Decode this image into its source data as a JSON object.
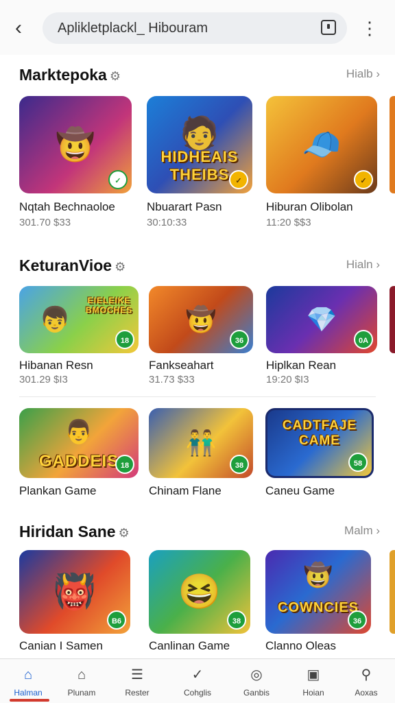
{
  "header": {
    "back_icon": "arrow-left-icon",
    "search_text": "Aplikletplackl_ Hibouram",
    "search_icon": "square-icon",
    "menu_icon": "kebab-icon"
  },
  "sections": [
    {
      "title": "Marktepoka",
      "more": "Hialb",
      "cards": [
        {
          "name": "Nqtah Bechnaoloe",
          "meta": "301.70 $33",
          "badge": "✓",
          "thumb_text": ""
        },
        {
          "name": "Nbuarart Pasn",
          "meta": "30:10:33",
          "badge": "✓",
          "thumb_text": "HIDHEAIS THEIBS"
        },
        {
          "name": "Hiburan Olibolan",
          "meta": "11:20 $$3",
          "badge": "✓",
          "thumb_text": ""
        }
      ]
    },
    {
      "title": "KeturanVioe",
      "more": "Hialn",
      "cards": [
        {
          "name": "Hibanan Resn",
          "meta": "301.29 $I3",
          "badge": "18",
          "thumb_text": "EIELEIKE BMOCHES"
        },
        {
          "name": "Fankseahart",
          "meta": "31.73 $33",
          "badge": "36",
          "thumb_text": ""
        },
        {
          "name": "Hiplkan Rean",
          "meta": "19:20 $I3",
          "badge": "0A",
          "thumb_text": ""
        }
      ]
    },
    {
      "title": "",
      "more": "",
      "cards": [
        {
          "name": "Plankan Game",
          "meta": "",
          "badge": "18",
          "thumb_text": "GADDEIS"
        },
        {
          "name": "Chinam Flane",
          "meta": "",
          "badge": "38",
          "thumb_text": ""
        },
        {
          "name": "Caneu Game",
          "meta": "",
          "badge": "58",
          "thumb_text": "CADTFAJE CAME"
        }
      ]
    },
    {
      "title": "Hiridan Sane",
      "more": "Malm",
      "cards": [
        {
          "name": "Canian I Samen",
          "meta": "",
          "badge": "B6",
          "thumb_text": ""
        },
        {
          "name": "Canlinan Game",
          "meta": "",
          "badge": "38",
          "thumb_text": ""
        },
        {
          "name": "Clanno Oleas",
          "meta": "",
          "badge": "36",
          "thumb_text": "COWNCIES"
        }
      ]
    }
  ],
  "bottom_nav": [
    {
      "label": "Halman",
      "icon": "home-icon",
      "active": true
    },
    {
      "label": "Plunam",
      "icon": "store-icon",
      "active": false
    },
    {
      "label": "Rester",
      "icon": "list-icon",
      "active": false
    },
    {
      "label": "Cohglis",
      "icon": "check-icon",
      "active": false
    },
    {
      "label": "Ganbis",
      "icon": "compass-icon",
      "active": false
    },
    {
      "label": "Hoian",
      "icon": "gamepad-icon",
      "active": false
    },
    {
      "label": "Aoxas",
      "icon": "search-icon",
      "active": false
    }
  ],
  "colors": {
    "accent": "#1a5fd0",
    "badge_green": "#1e9e3c",
    "active_indicator": "#d23a2e"
  }
}
